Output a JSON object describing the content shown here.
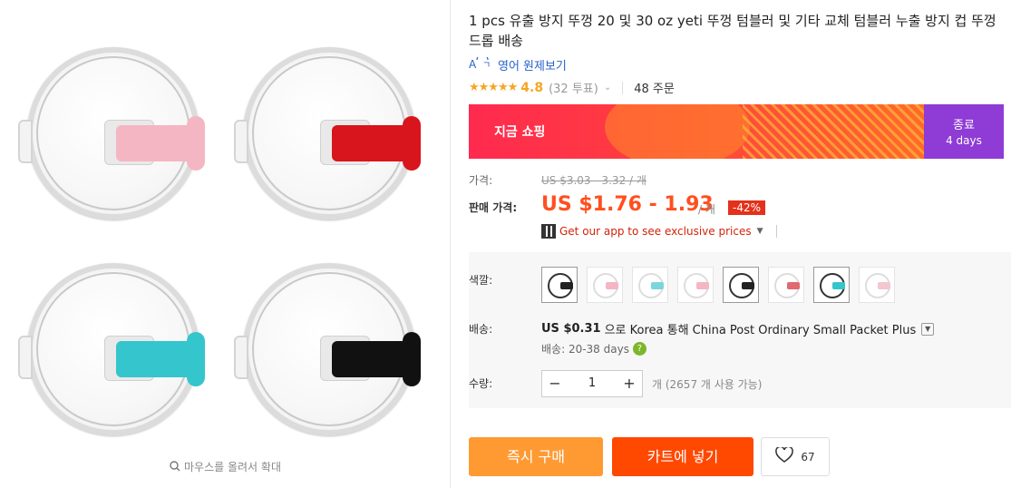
{
  "gallery": {
    "zoom_hint": "마우스를 올려서 확대",
    "lids": [
      {
        "color": "#f4b6c2"
      },
      {
        "color": "#d8141c"
      },
      {
        "color": "#35c5cc"
      },
      {
        "color": "#111111"
      }
    ]
  },
  "product": {
    "title": "1 pcs 유출 방지 뚜껑 20 및 30 oz yeti 뚜껑 텀블러 및 기타 교체 텀블러 누출 방지 컵 뚜껑 드롭 배송",
    "translate_link": "영어 원제보기",
    "stars": "★★★★★",
    "rating": "4.8",
    "reviews": "(32 투표)",
    "orders": "48 주문"
  },
  "promo": {
    "banner_label": "지금 쇼핑",
    "ends_label": "종료",
    "ends_days": "4 days"
  },
  "price": {
    "list_label": "가격:",
    "list_value": "US $3.03 - 3.32 / 개",
    "sale_label": "판매 가격:",
    "sale_value": "US $1.76 - 1.93",
    "per_unit": "/ 개",
    "discount": "-42%",
    "app_link": "Get our app to see exclusive prices"
  },
  "options": {
    "color_label": "색깔:",
    "swatches": [
      {
        "tab": "#222222",
        "dark": true
      },
      {
        "tab": "#f4b6c2",
        "dark": false
      },
      {
        "tab": "#7ad6dc",
        "dark": false
      },
      {
        "tab": "#f4b6c2",
        "dark": false
      },
      {
        "tab": "#222222",
        "dark": true
      },
      {
        "tab": "#e06a70",
        "dark": false
      },
      {
        "tab": "#35c5cc",
        "dark": true
      },
      {
        "tab": "#f4c7cf",
        "dark": false
      }
    ],
    "shipping_label": "배송:",
    "shipping_price": "US $0.31",
    "shipping_text": "으로 Korea 통해 China Post Ordinary Small Packet Plus",
    "delivery": "배송: 20-38 days",
    "quantity_label": "수량:",
    "quantity": "1",
    "availability": "개 (2657 개 사용 가능)"
  },
  "actions": {
    "buy_now": "즉시 구매",
    "add_to_cart": "카트에 넣기",
    "wishlist_count": "67"
  }
}
